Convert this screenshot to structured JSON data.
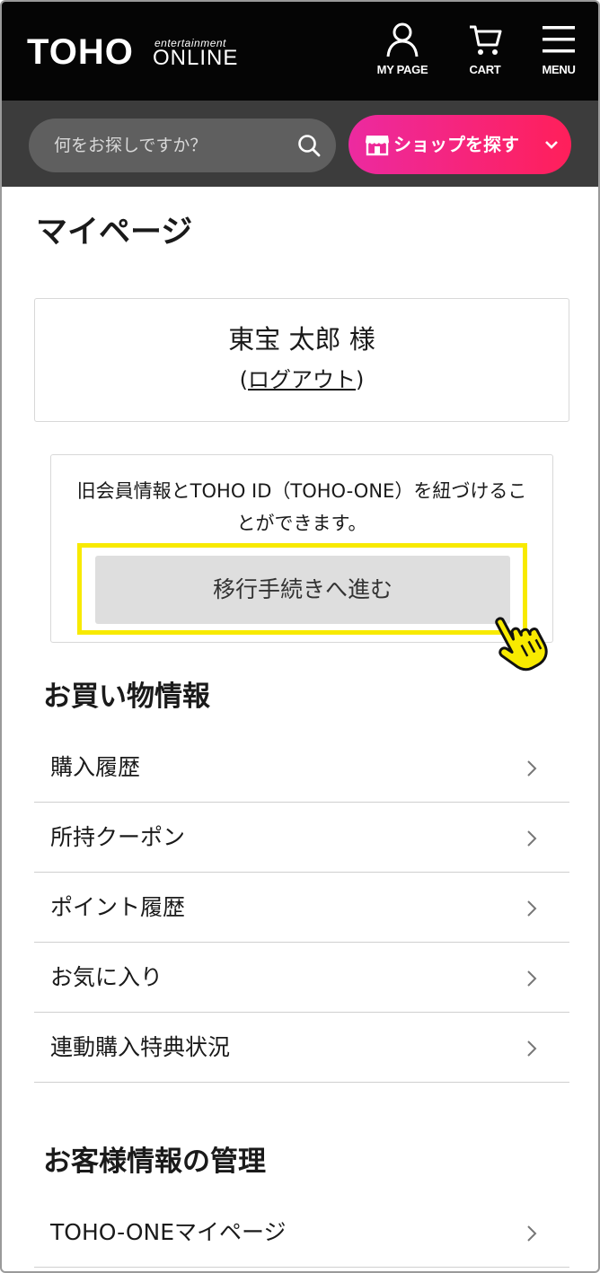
{
  "header": {
    "logo_main": "TOHO",
    "logo_sub_small": "entertainment",
    "logo_sub_big": "ONLINE",
    "mypage_label": "MY PAGE",
    "cart_label": "CART",
    "menu_label": "MENU",
    "mypage_icon": "user-icon",
    "cart_icon": "cart-icon",
    "menu_icon": "hamburger-icon"
  },
  "search": {
    "placeholder": "何をお探しですか？",
    "value": "",
    "icon": "search-icon"
  },
  "shop_button": {
    "label": "ショップを探す",
    "icon": "shop-icon",
    "chevron": "chevron-down-icon"
  },
  "page": {
    "title": "マイページ"
  },
  "user": {
    "name": "東宝 太郎 様",
    "logout_open": "(",
    "logout_label": "ログアウト",
    "logout_close": ")"
  },
  "migration": {
    "text": "旧会員情報とTOHO ID（TOHO-ONE）を紐づけることができます。",
    "button_label": "移行手続きへ進む",
    "highlight_color": "#f8ea00",
    "pointer_icon": "pointing-hand-icon"
  },
  "shopping_info": {
    "title": "お買い物情報",
    "items": [
      {
        "label": "購入履歴"
      },
      {
        "label": "所持クーポン"
      },
      {
        "label": "ポイント履歴"
      },
      {
        "label": "お気に入り"
      },
      {
        "label": "連動購入特典状況"
      }
    ]
  },
  "customer_info": {
    "title": "お客様情報の管理",
    "items": [
      {
        "label": "TOHO-ONEマイページ"
      }
    ]
  },
  "colors": {
    "header_bg": "#050505",
    "search_bar_bg": "#3c3c3c",
    "shop_gradient_start": "#ec2aa0",
    "shop_gradient_end": "#ff1f5a",
    "button_bg": "#dedede"
  }
}
